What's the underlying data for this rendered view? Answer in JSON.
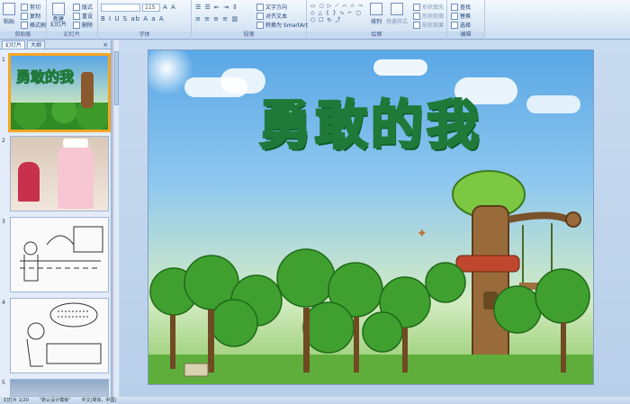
{
  "ribbon": {
    "clipboard": {
      "paste": "粘贴",
      "cut": "剪切",
      "copy": "复制",
      "format_painter": "格式刷",
      "label": "剪贴板"
    },
    "slides": {
      "new_slide": "新建\n幻灯片",
      "layout": "版式",
      "reset": "重设",
      "delete": "删除",
      "label": "幻灯片"
    },
    "font": {
      "size": "115",
      "label": "字体"
    },
    "paragraph": {
      "text_direction": "文字方向",
      "align_text": "对齐文本",
      "smartart": "转换为 SmartArt",
      "label": "段落"
    },
    "drawing": {
      "arrange": "排列",
      "quick_styles": "快速样式",
      "shape_fill": "形状填充",
      "shape_outline": "形状轮廓",
      "shape_effects": "形状效果",
      "label": "绘图"
    },
    "editing": {
      "find": "查找",
      "replace": "替换",
      "select": "选择",
      "label": "编辑"
    }
  },
  "panel": {
    "tabs": [
      "幻灯片",
      "大纲"
    ],
    "close": "×",
    "thumbs": [
      {
        "num": "1",
        "title": "勇敢的我"
      },
      {
        "num": "2"
      },
      {
        "num": "3"
      },
      {
        "num": "4"
      },
      {
        "num": "5"
      }
    ]
  },
  "slide": {
    "title": "勇敢的我"
  },
  "status": {
    "slide_no": "幻灯片 1/20",
    "theme": "\"默认设计模板\"",
    "lang": "中文(简体，中国)"
  }
}
